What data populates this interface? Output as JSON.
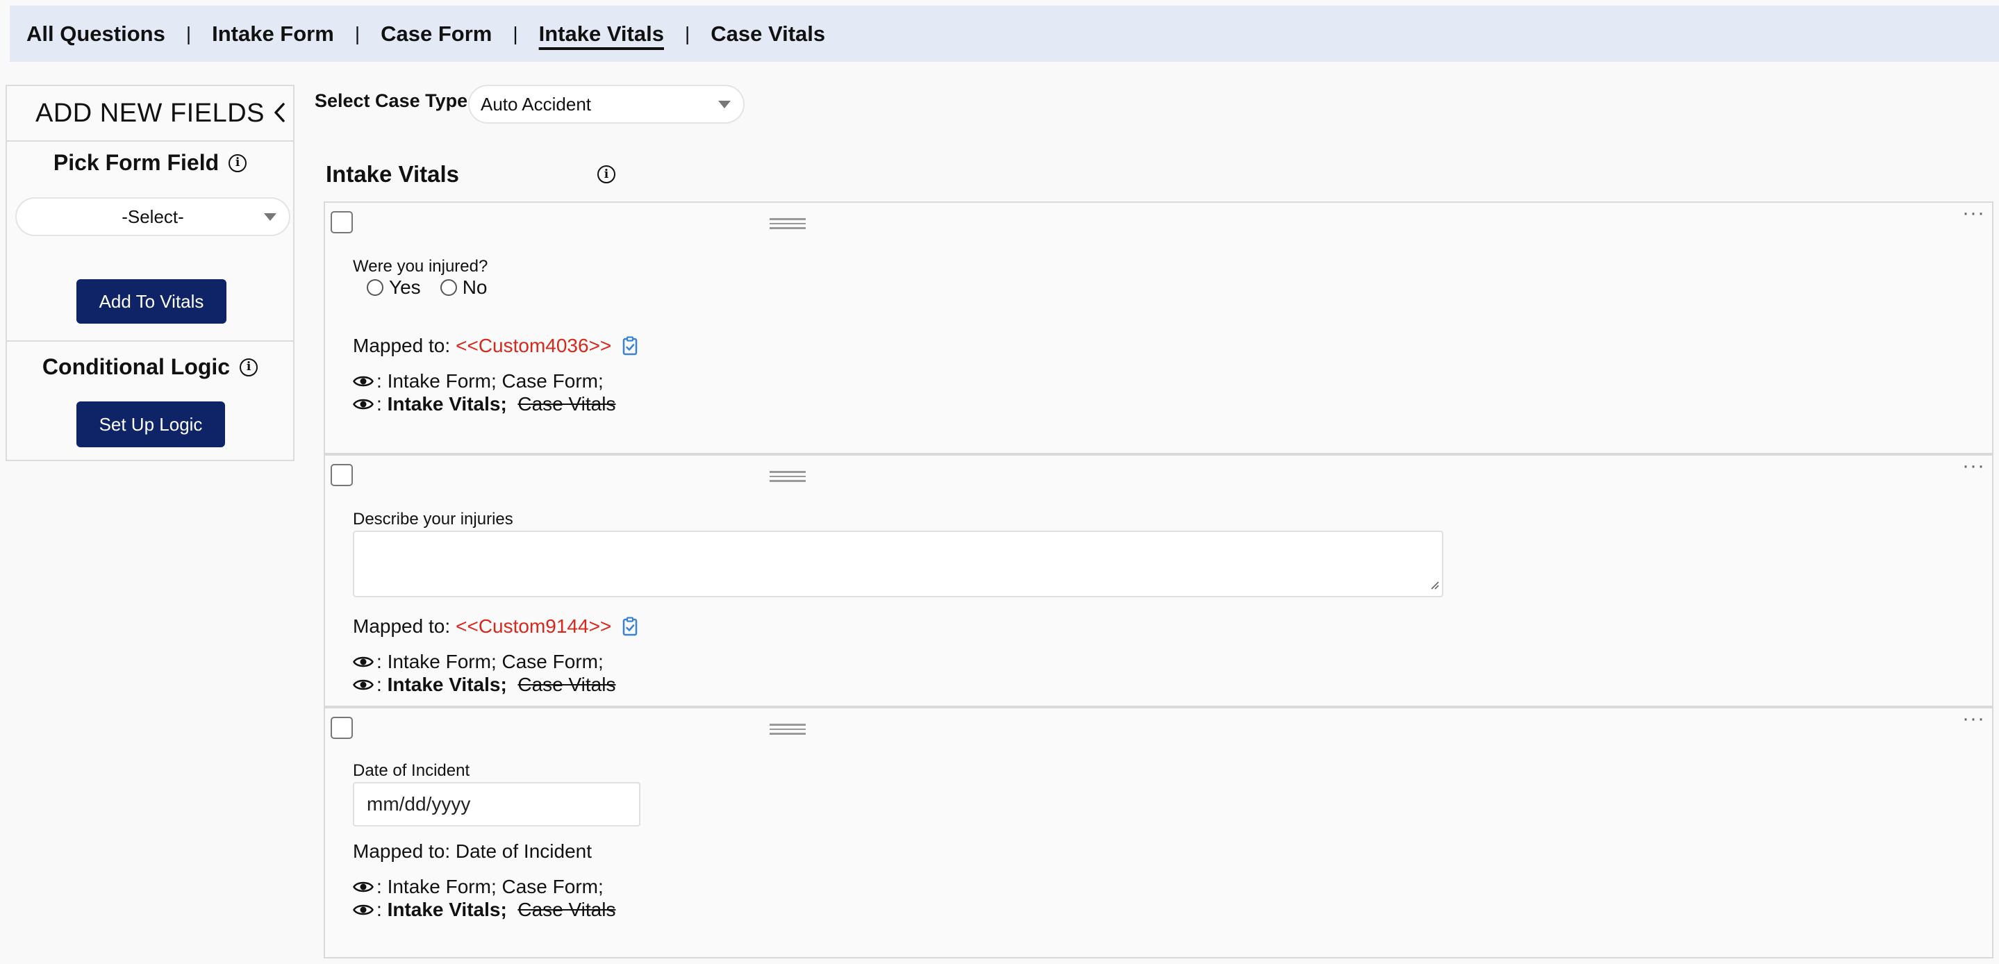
{
  "nav": {
    "tabs": [
      {
        "label": "All Questions"
      },
      {
        "label": "Intake Form"
      },
      {
        "label": "Case Form"
      },
      {
        "label": "Intake Vitals",
        "active": true
      },
      {
        "label": "Case Vitals"
      }
    ],
    "separator": "|"
  },
  "left_panel": {
    "header": "ADD NEW FIELDS",
    "pick_title": "Pick Form Field",
    "select_value": "-Select-",
    "add_button": "Add To Vitals",
    "logic_title": "Conditional Logic",
    "logic_button": "Set Up Logic"
  },
  "case_type": {
    "label": "Select Case Type",
    "value": "Auto Accident"
  },
  "section": {
    "title": "Intake Vitals"
  },
  "common": {
    "mapped_prefix": "Mapped to:",
    "vis_colon": ":",
    "vis_line1": "Intake Form;  Case Form;",
    "vis_intake_vitals": "Intake Vitals;",
    "vis_case_vitals": "Case Vitals"
  },
  "fields": [
    {
      "question": "Were you injured?",
      "options": [
        "Yes",
        "No"
      ],
      "mapped_token": "<<Custom4036>>"
    },
    {
      "question": "Describe your injuries",
      "mapped_token": "<<Custom9144>>"
    },
    {
      "question": "Date of Incident",
      "placeholder": "mm/dd/yyyy",
      "mapped_plain": "Mapped to: Date of Incident"
    }
  ],
  "colors": {
    "nav_bg": "#e3eaf6",
    "button_navy": "#0f2466",
    "token_red": "#d8281c",
    "clip_blue": "#3b82d6"
  },
  "icons": [
    "chevron-left-icon",
    "info-icon",
    "drag-handle-icon",
    "more-options-icon",
    "clipboard-check-icon",
    "eye-icon",
    "caret-down-icon",
    "resize-grip-icon"
  ]
}
